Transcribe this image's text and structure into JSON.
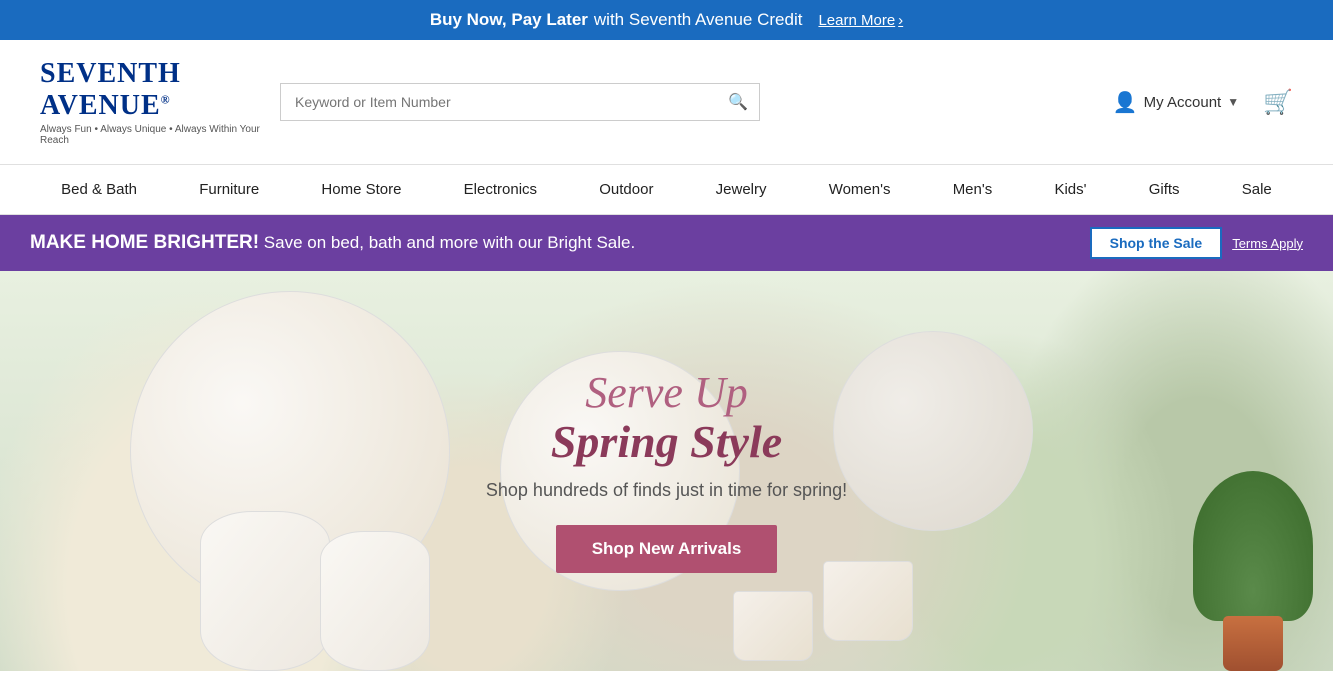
{
  "topBanner": {
    "text_bold": "Buy Now, Pay Later",
    "text_normal": " with Seventh Avenue Credit",
    "learn_more": "Learn More",
    "arrow": "›"
  },
  "header": {
    "logo": {
      "text": "Seventh Avenue",
      "registered": "®",
      "tagline": "Always Fun • Always Unique • Always Within Your Reach"
    },
    "search": {
      "placeholder": "Keyword or Item Number"
    },
    "account": {
      "label": "My Account"
    },
    "cart": {
      "label": "Cart"
    }
  },
  "nav": {
    "items": [
      {
        "label": "Bed & Bath"
      },
      {
        "label": "Furniture"
      },
      {
        "label": "Home Store"
      },
      {
        "label": "Electronics"
      },
      {
        "label": "Outdoor"
      },
      {
        "label": "Jewelry"
      },
      {
        "label": "Women's"
      },
      {
        "label": "Men's"
      },
      {
        "label": "Kids'"
      },
      {
        "label": "Gifts"
      },
      {
        "label": "Sale"
      }
    ]
  },
  "promoBanner": {
    "bold": "MAKE HOME BRIGHTER!",
    "text": " Save on bed, bath and more with our Bright Sale.",
    "shopSale": "Shop the Sale",
    "termsApply": "Terms Apply"
  },
  "hero": {
    "titleLine1": "Serve Up",
    "titleLine2": "Spring Style",
    "subtitle": "Shop hundreds of finds just in time for spring!",
    "cta": "Shop New Arrivals"
  }
}
